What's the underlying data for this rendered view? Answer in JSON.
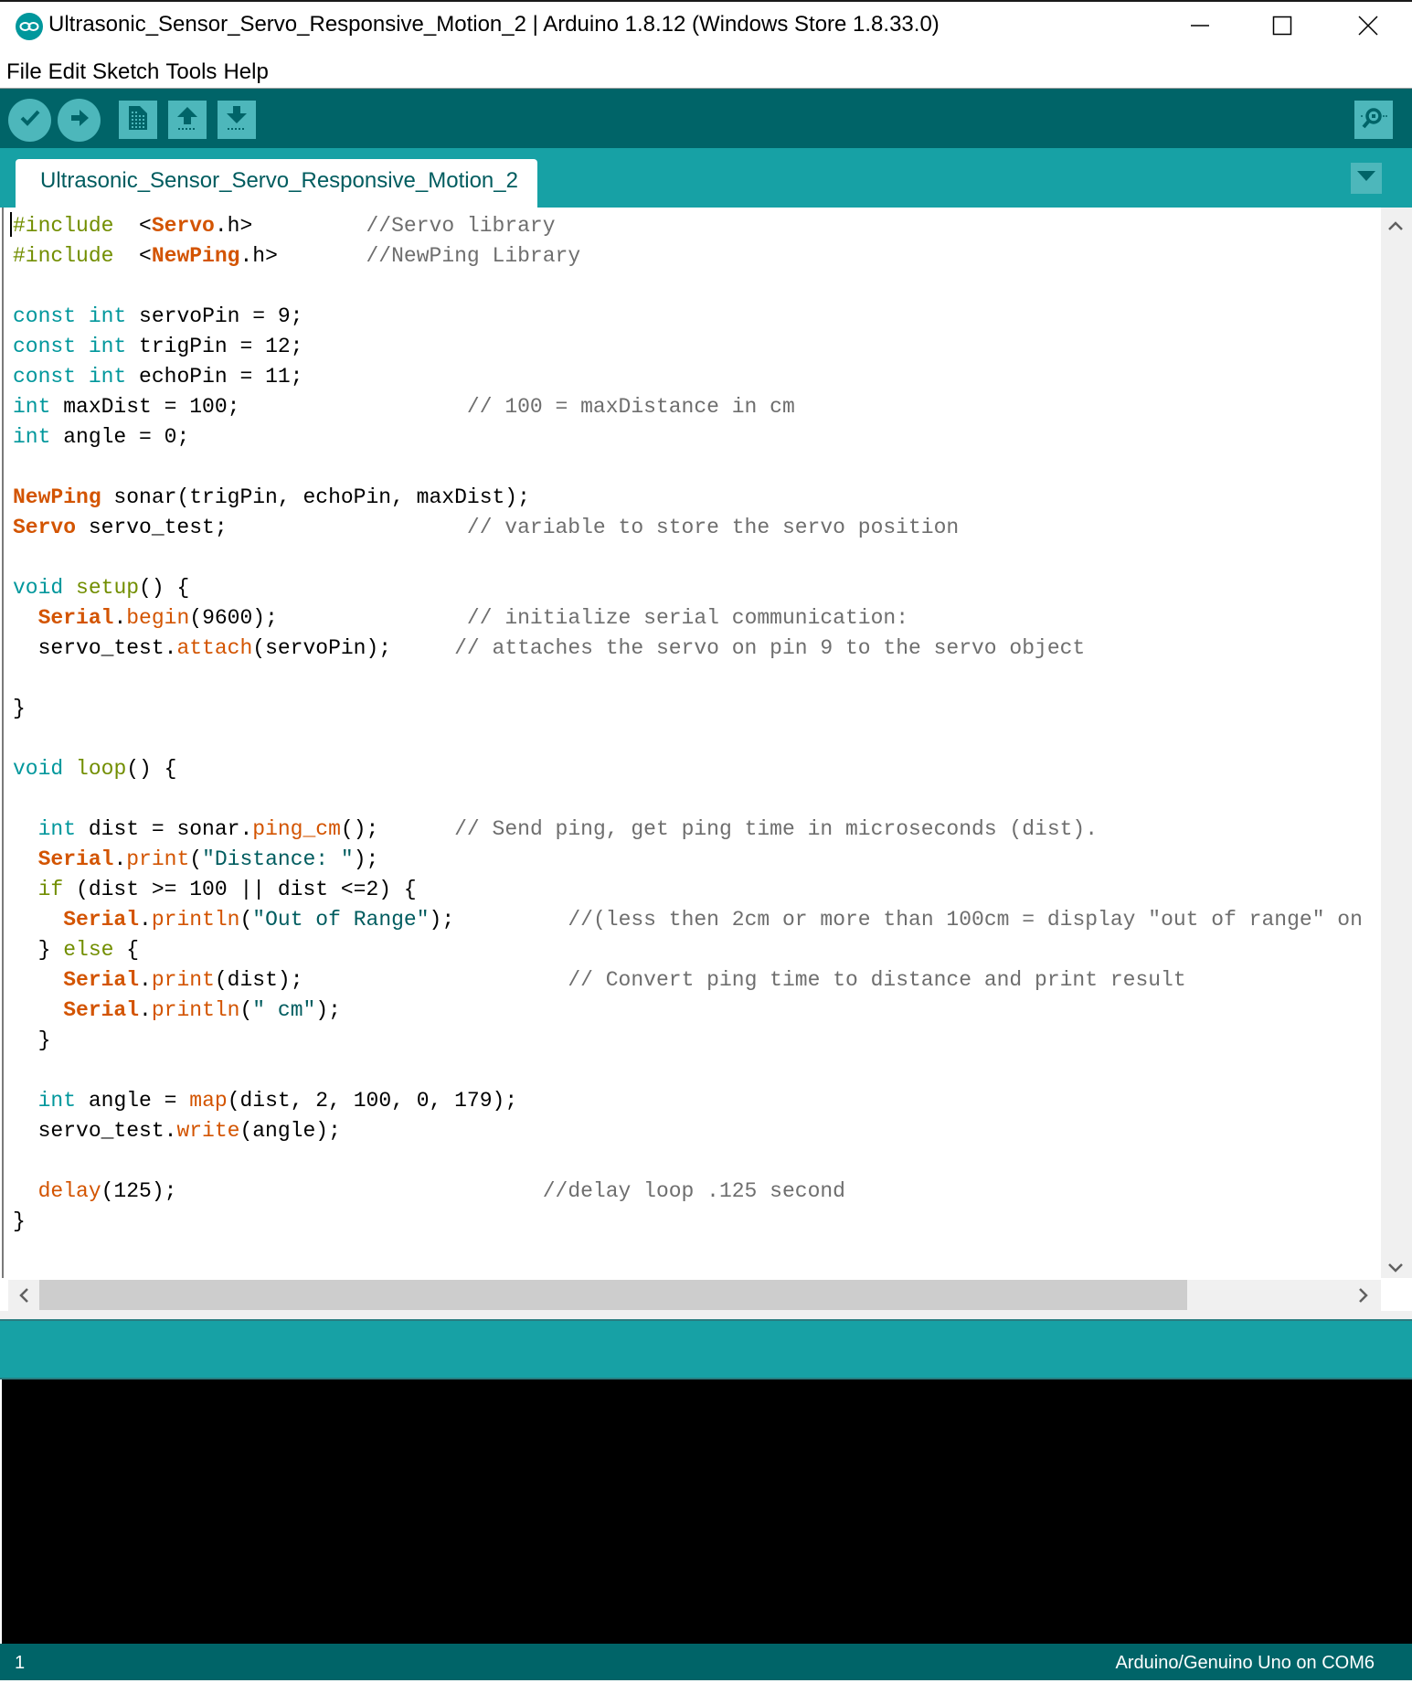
{
  "window": {
    "title": "Ultrasonic_Sensor_Servo_Responsive_Motion_2 | Arduino 1.8.12 (Windows Store 1.8.33.0)",
    "controls": [
      "minimize",
      "maximize",
      "close"
    ]
  },
  "menu": {
    "items": [
      "File",
      "Edit",
      "Sketch",
      "Tools",
      "Help"
    ]
  },
  "toolbar": {
    "buttons": [
      {
        "name": "Verify",
        "icon": "check-icon"
      },
      {
        "name": "Upload",
        "icon": "arrow-right-icon"
      },
      {
        "name": "New",
        "icon": "new-file-icon"
      },
      {
        "name": "Open",
        "icon": "arrow-up-icon"
      },
      {
        "name": "Save",
        "icon": "arrow-down-icon"
      }
    ],
    "serial_monitor": {
      "name": "Serial Monitor",
      "icon": "magnifier-icon"
    }
  },
  "tabs": [
    {
      "label": "Ultrasonic_Sensor_Servo_Responsive_Motion_2",
      "active": true
    }
  ],
  "colors": {
    "toolbar_bg": "#006468",
    "tabbar_bg": "#17a1a5",
    "button_bg": "#4db7bb",
    "keyword": "#728e00",
    "type": "#00979c",
    "function": "#d35400",
    "string": "#005c5f",
    "comment": "#6e6e6e"
  },
  "editor": {
    "lines": [
      [
        [
          "kw",
          "#include"
        ],
        [
          "",
          "  <"
        ],
        [
          "cls",
          "Servo"
        ],
        [
          "",
          ".h>         "
        ],
        [
          "cm",
          "//Servo library"
        ]
      ],
      [
        [
          "kw",
          "#include"
        ],
        [
          "",
          "  <"
        ],
        [
          "cls",
          "NewPing"
        ],
        [
          "",
          ".h>       "
        ],
        [
          "cm",
          "//NewPing Library"
        ]
      ],
      [],
      [
        [
          "ty",
          "const"
        ],
        [
          "",
          " "
        ],
        [
          "ty",
          "int"
        ],
        [
          "",
          " servoPin = 9;"
        ]
      ],
      [
        [
          "ty",
          "const"
        ],
        [
          "",
          " "
        ],
        [
          "ty",
          "int"
        ],
        [
          "",
          " trigPin = 12;"
        ]
      ],
      [
        [
          "ty",
          "const"
        ],
        [
          "",
          " "
        ],
        [
          "ty",
          "int"
        ],
        [
          "",
          " echoPin = 11;"
        ]
      ],
      [
        [
          "ty",
          "int"
        ],
        [
          "",
          " maxDist = 100;                  "
        ],
        [
          "cm",
          "// 100 = maxDistance in cm"
        ]
      ],
      [
        [
          "ty",
          "int"
        ],
        [
          "",
          " angle = 0;"
        ]
      ],
      [],
      [
        [
          "cls",
          "NewPing"
        ],
        [
          "",
          " sonar(trigPin, echoPin, maxDist);"
        ]
      ],
      [
        [
          "cls",
          "Servo"
        ],
        [
          "",
          " servo_test;                   "
        ],
        [
          "cm",
          "// variable to store the servo position"
        ]
      ],
      [],
      [
        [
          "ty",
          "void"
        ],
        [
          "",
          " "
        ],
        [
          "kw",
          "setup"
        ],
        [
          "",
          "() {"
        ]
      ],
      [
        [
          "",
          "  "
        ],
        [
          "cls",
          "Serial"
        ],
        [
          "",
          "."
        ],
        [
          "fn",
          "begin"
        ],
        [
          "",
          "(9600);               "
        ],
        [
          "cm",
          "// initialize serial communication:"
        ]
      ],
      [
        [
          "",
          "  servo_test."
        ],
        [
          "fn",
          "attach"
        ],
        [
          "",
          "(servoPin);     "
        ],
        [
          "cm",
          "// attaches the servo on pin 9 to the servo object"
        ]
      ],
      [],
      [
        [
          "",
          "}"
        ]
      ],
      [],
      [
        [
          "ty",
          "void"
        ],
        [
          "",
          " "
        ],
        [
          "kw",
          "loop"
        ],
        [
          "",
          "() {"
        ]
      ],
      [],
      [
        [
          "",
          "  "
        ],
        [
          "ty",
          "int"
        ],
        [
          "",
          " dist = sonar."
        ],
        [
          "fn",
          "ping_cm"
        ],
        [
          "",
          "();      "
        ],
        [
          "cm",
          "// Send ping, get ping time in microseconds (dist)."
        ]
      ],
      [
        [
          "",
          "  "
        ],
        [
          "cls",
          "Serial"
        ],
        [
          "",
          "."
        ],
        [
          "fn",
          "print"
        ],
        [
          "",
          "("
        ],
        [
          "str",
          "\"Distance: \""
        ],
        [
          "",
          ");"
        ]
      ],
      [
        [
          "",
          "  "
        ],
        [
          "kw",
          "if"
        ],
        [
          "",
          " (dist >= 100 || dist <=2) {"
        ]
      ],
      [
        [
          "",
          "    "
        ],
        [
          "cls",
          "Serial"
        ],
        [
          "",
          "."
        ],
        [
          "fn",
          "println"
        ],
        [
          "",
          "("
        ],
        [
          "str",
          "\"Out of Range\""
        ],
        [
          "",
          ");         "
        ],
        [
          "cm",
          "//(less then 2cm or more than 100cm = display \"out of range\" on"
        ]
      ],
      [
        [
          "",
          "  } "
        ],
        [
          "kw",
          "else"
        ],
        [
          "",
          " {"
        ]
      ],
      [
        [
          "",
          "    "
        ],
        [
          "cls",
          "Serial"
        ],
        [
          "",
          "."
        ],
        [
          "fn",
          "print"
        ],
        [
          "",
          "(dist);                     "
        ],
        [
          "cm",
          "// Convert ping time to distance and print result"
        ]
      ],
      [
        [
          "",
          "    "
        ],
        [
          "cls",
          "Serial"
        ],
        [
          "",
          "."
        ],
        [
          "fn",
          "println"
        ],
        [
          "",
          "("
        ],
        [
          "str",
          "\" cm\""
        ],
        [
          "",
          ");"
        ]
      ],
      [
        [
          "",
          "  }"
        ]
      ],
      [],
      [
        [
          "",
          "  "
        ],
        [
          "ty",
          "int"
        ],
        [
          "",
          " angle = "
        ],
        [
          "fn",
          "map"
        ],
        [
          "",
          "(dist, 2, 100, 0, 179);"
        ]
      ],
      [
        [
          "",
          "  servo_test."
        ],
        [
          "fn",
          "write"
        ],
        [
          "",
          "(angle);"
        ]
      ],
      [],
      [
        [
          "",
          "  "
        ],
        [
          "fn",
          "delay"
        ],
        [
          "",
          "(125);                             "
        ],
        [
          "cm",
          "//delay loop .125 second"
        ]
      ],
      [
        [
          "",
          "}"
        ]
      ]
    ],
    "horizontal_scroll_fraction": 0.0,
    "vertical_scroll_fraction": 0.0
  },
  "console": {
    "text": ""
  },
  "statusbar": {
    "line_number": "1",
    "board_info": "Arduino/Genuino Uno on COM6"
  }
}
